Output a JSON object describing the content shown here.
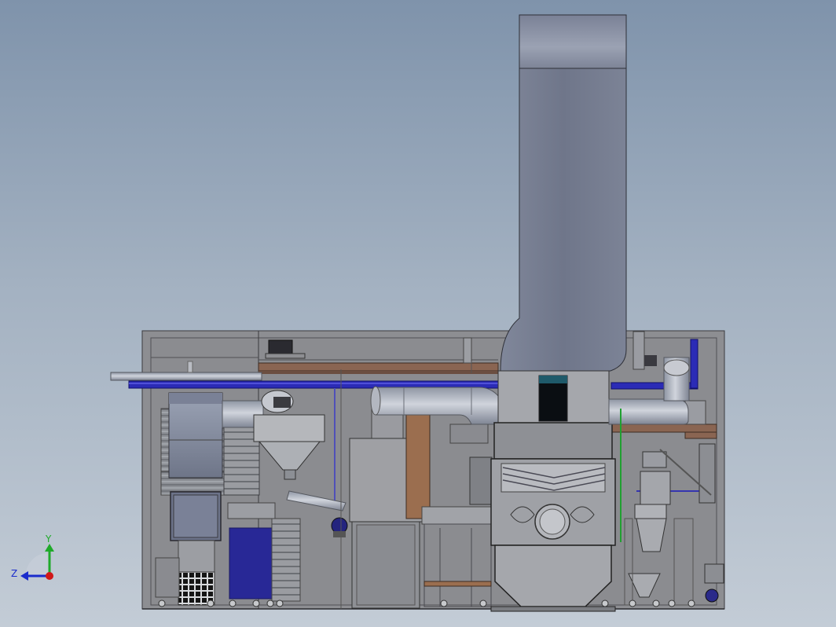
{
  "view": {
    "background_top": "#7f93ab",
    "background_bottom": "#c3ccd6"
  },
  "triad": {
    "y_label": "Y",
    "z_label": "Z",
    "y_color": "#1faa2a",
    "z_color": "#1a2ccc",
    "x_color": "#d01818"
  },
  "colors": {
    "steel": "#8a8c93",
    "stack": "#727a8c",
    "pipe": "#a9afbb",
    "blue_pipe": "#2a2ab5",
    "copper": "#b07a52",
    "glass": "#2c2c9a",
    "dark": "#101418"
  }
}
